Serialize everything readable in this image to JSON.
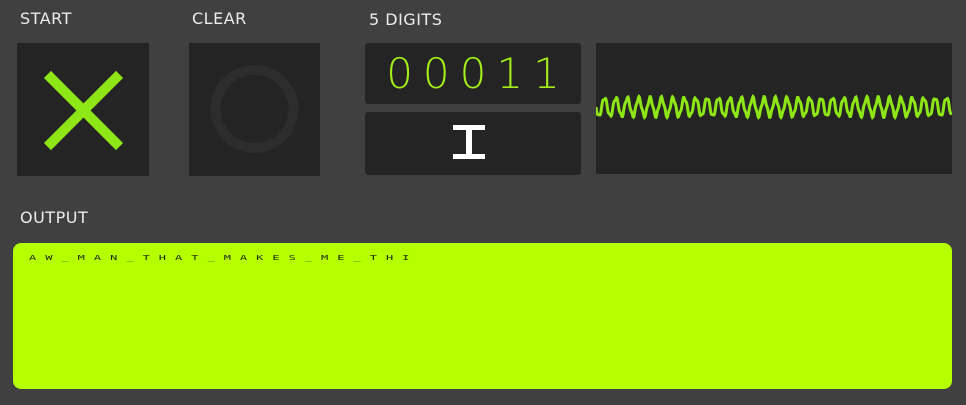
{
  "labels": {
    "start": "START",
    "clear": "CLEAR",
    "digits": "5 DIGITS",
    "output": "OUTPUT"
  },
  "display": {
    "digits_value": "00011"
  },
  "output": {
    "text": "AW_MAN_THAT_MAKES_ME_THI"
  },
  "icons": {
    "start": "x-icon",
    "clear": "circle-icon",
    "cursor": "text-cursor-icon",
    "waveform": "waveform-icon"
  },
  "colors": {
    "background": "#404040",
    "panel": "#242424",
    "accent_green": "#8ee617",
    "digit_green": "#a4ef19",
    "output_bg": "#b5ff00",
    "output_text": "#1b2a00",
    "clear_ring": "#2d2d2d"
  }
}
